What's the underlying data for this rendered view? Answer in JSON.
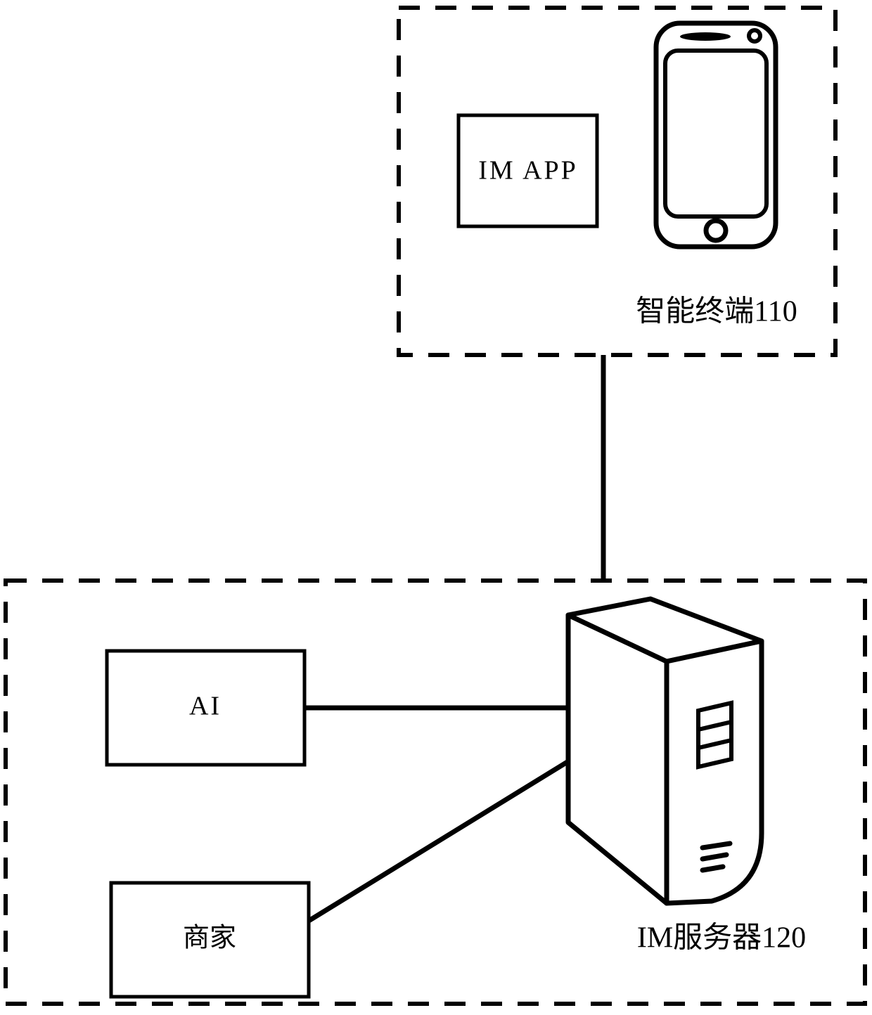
{
  "figure": {
    "kind": "system-architecture-block-diagram",
    "background_color": "#ffffff",
    "stroke_color": "#000000"
  },
  "terminal_region": {
    "label": "智能终端110",
    "app_box": {
      "label": "IM APP"
    },
    "device_icon_name": "smartphone-icon"
  },
  "server_region": {
    "label": "IM服务器120",
    "device_icon_name": "server-tower-icon",
    "boxes": [
      {
        "label": "AI"
      },
      {
        "label": "商家"
      }
    ]
  },
  "connections": [
    {
      "from": "智能终端110",
      "to": "IM服务器120"
    },
    {
      "from": "AI",
      "to": "IM服务器120"
    },
    {
      "from": "商家",
      "to": "IM服务器120"
    }
  ]
}
